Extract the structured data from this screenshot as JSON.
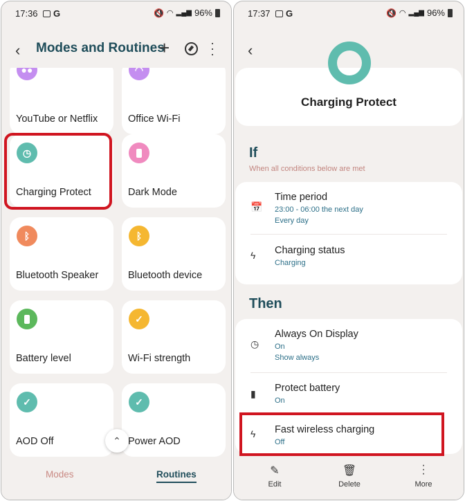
{
  "left": {
    "status": {
      "time": "17:36",
      "battery": "96%"
    },
    "header": {
      "title": "Modes and Routines"
    },
    "tiles": [
      {
        "label": "YouTube or Netflix",
        "color": "#c48ef0",
        "icon": "dots-icon"
      },
      {
        "label": "Office Wi-Fi",
        "color": "#c48ef0",
        "icon": "wifi-icon"
      },
      {
        "label": "Charging Protect",
        "color": "#5fbcae",
        "icon": "clock-icon"
      },
      {
        "label": "Dark Mode",
        "color": "#f08abf",
        "icon": "battery-icon"
      },
      {
        "label": "Bluetooth Speaker",
        "color": "#f08a5d",
        "icon": "bluetooth-icon"
      },
      {
        "label": "Bluetooth device",
        "color": "#f5b731",
        "icon": "bluetooth-icon"
      },
      {
        "label": "Battery level",
        "color": "#5cb85c",
        "icon": "battery-icon"
      },
      {
        "label": "Wi-Fi strength",
        "color": "#f5b731",
        "icon": "check-icon"
      },
      {
        "label": "AOD Off",
        "color": "#5fbcae",
        "icon": "check-icon"
      },
      {
        "label": "Power AOD",
        "color": "#5fbcae",
        "icon": "check-icon"
      }
    ],
    "nav": {
      "modes": "Modes",
      "routines": "Routines"
    }
  },
  "right": {
    "status": {
      "time": "17:37",
      "battery": "96%"
    },
    "routine_title": "Charging Protect",
    "if_section": {
      "title": "If",
      "subtitle": "When all conditions below are met",
      "rows": [
        {
          "title": "Time period",
          "sub1": "23:00 - 06:00 the next day",
          "sub2": "Every day",
          "icon": "calendar-icon"
        },
        {
          "title": "Charging status",
          "sub1": "Charging",
          "icon": "bolt-icon"
        }
      ]
    },
    "then_section": {
      "title": "Then",
      "rows": [
        {
          "title": "Always On Display",
          "sub1": "On",
          "sub2": "Show always",
          "icon": "clock-icon"
        },
        {
          "title": "Protect battery",
          "sub1": "On",
          "icon": "battery-icon"
        },
        {
          "title": "Fast wireless charging",
          "sub1": "Off",
          "icon": "bolt-icon"
        }
      ]
    },
    "actions": {
      "edit": "Edit",
      "delete": "Delete",
      "more": "More"
    }
  }
}
